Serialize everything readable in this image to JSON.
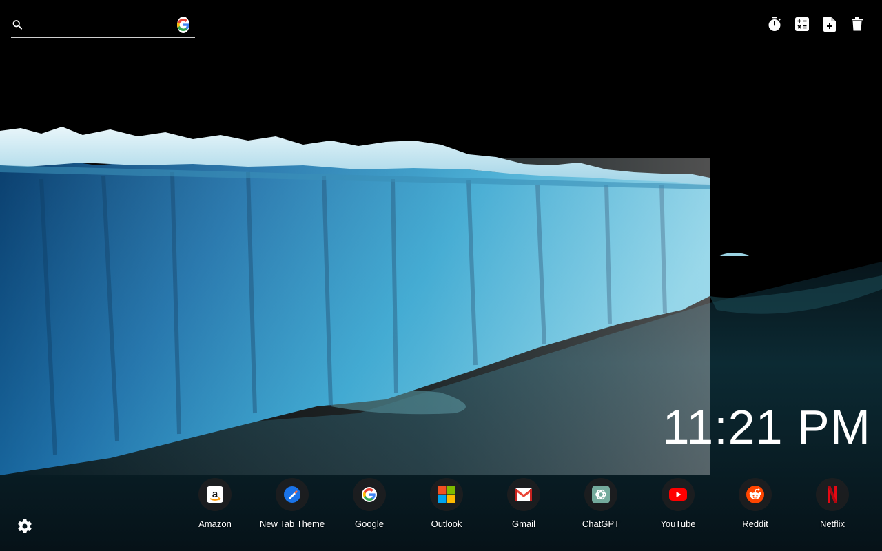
{
  "search": {
    "value": "",
    "placeholder": "",
    "engine_icon": "google-icon"
  },
  "toolbar": {
    "items": [
      {
        "icon": "timer-icon"
      },
      {
        "icon": "calculator-icon"
      },
      {
        "icon": "new-note-icon"
      },
      {
        "icon": "trash-icon"
      }
    ]
  },
  "clock": {
    "time": "11:21 PM"
  },
  "shortcuts": [
    {
      "label": "Amazon",
      "icon": "amazon-icon"
    },
    {
      "label": "New Tab Theme",
      "icon": "new-tab-theme-icon"
    },
    {
      "label": "Google",
      "icon": "google-icon"
    },
    {
      "label": "Outlook",
      "icon": "microsoft-icon"
    },
    {
      "label": "Gmail",
      "icon": "gmail-icon"
    },
    {
      "label": "ChatGPT",
      "icon": "chatgpt-icon"
    },
    {
      "label": "YouTube",
      "icon": "youtube-icon"
    },
    {
      "label": "Reddit",
      "icon": "reddit-icon"
    },
    {
      "label": "Netflix",
      "icon": "netflix-icon"
    }
  ],
  "settings": {
    "icon": "gear-icon"
  },
  "colors": {
    "ice_light": "#bfe7f2",
    "ice_mid": "#2aa3c9",
    "ice_dark": "#0d4d78",
    "water": "#0a1f26",
    "sky": "#000000"
  }
}
